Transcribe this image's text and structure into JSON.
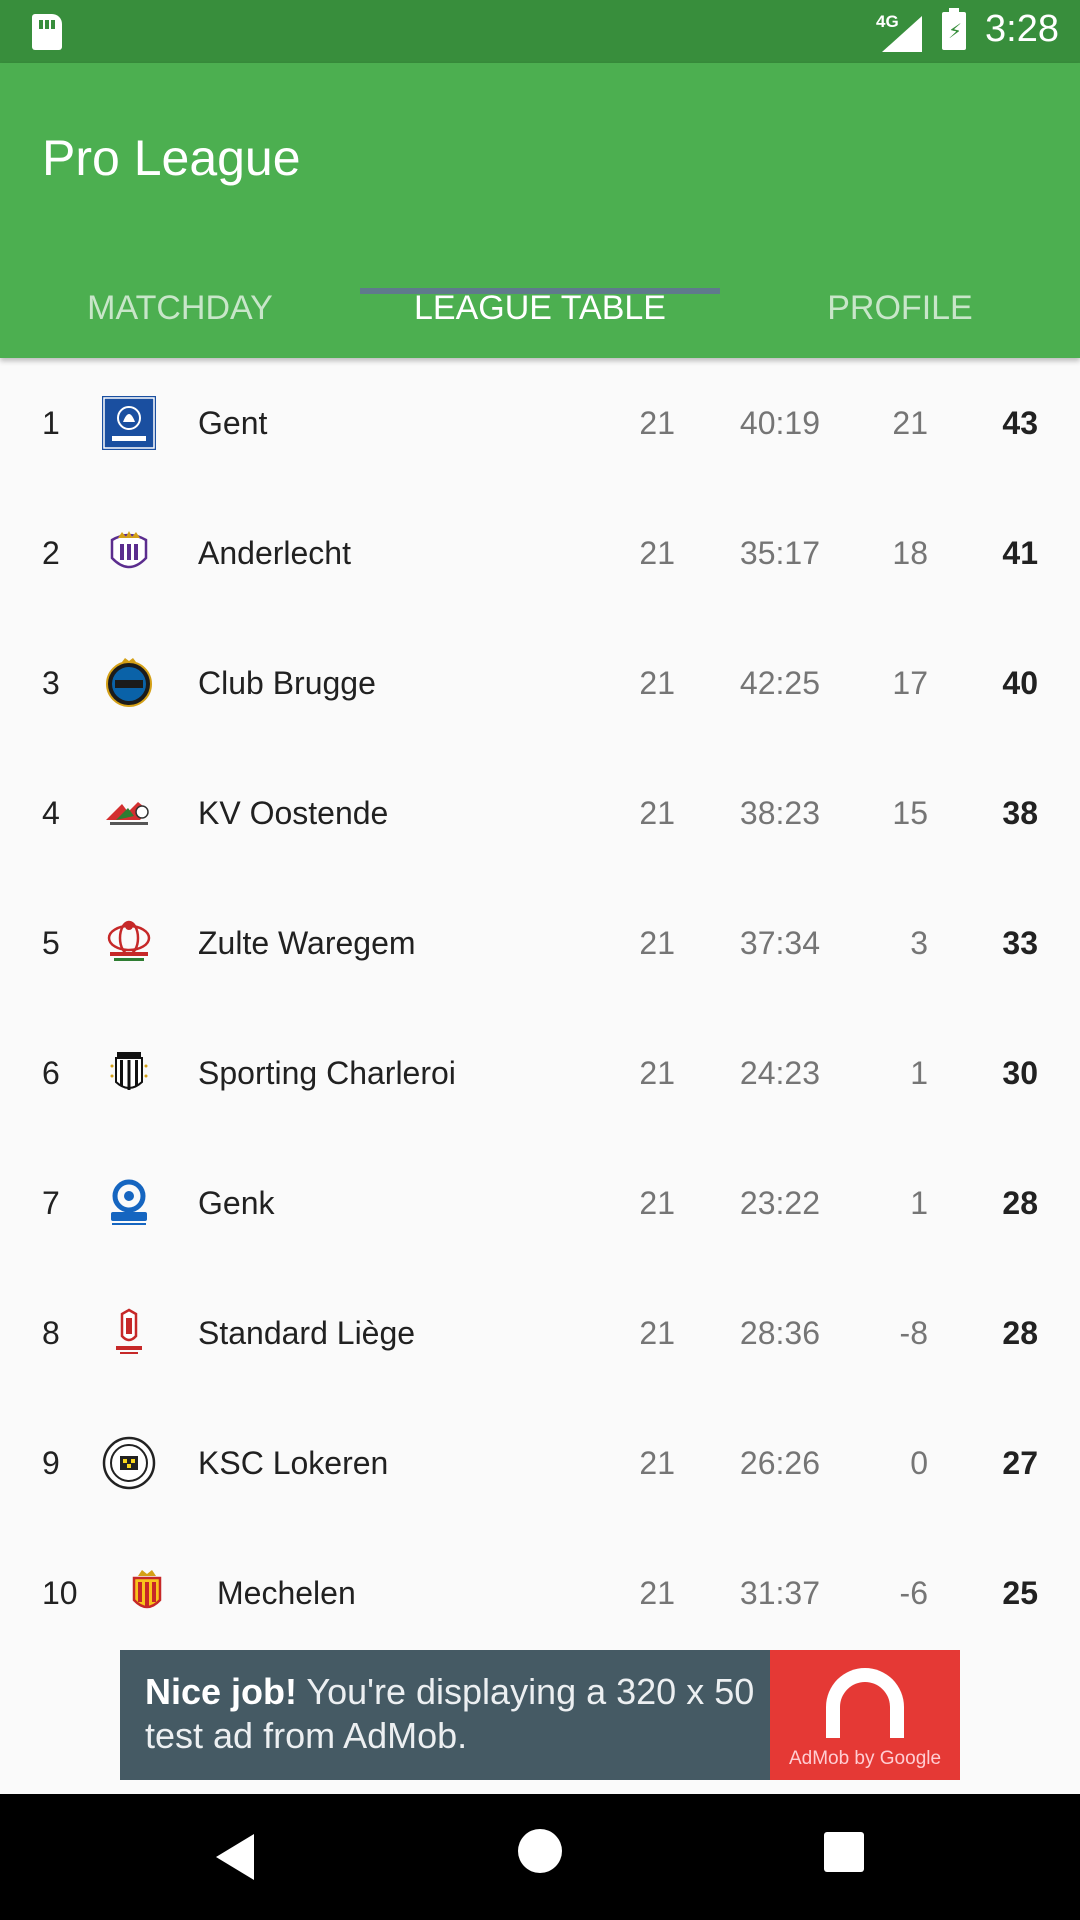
{
  "status_bar": {
    "network": "4G",
    "time": "3:28"
  },
  "app": {
    "title": "Pro League",
    "primary_color": "#4caf50",
    "status_color": "#388e3c"
  },
  "tabs": [
    {
      "label": "MATCHDAY",
      "active": false
    },
    {
      "label": "LEAGUE TABLE",
      "active": true
    },
    {
      "label": "PROFILE",
      "active": false
    }
  ],
  "standings": [
    {
      "rank": "1",
      "team": "Gent",
      "played": "21",
      "goals": "40:19",
      "goal_diff": "21",
      "points": "43"
    },
    {
      "rank": "2",
      "team": "Anderlecht",
      "played": "21",
      "goals": "35:17",
      "goal_diff": "18",
      "points": "41"
    },
    {
      "rank": "3",
      "team": "Club Brugge",
      "played": "21",
      "goals": "42:25",
      "goal_diff": "17",
      "points": "40"
    },
    {
      "rank": "4",
      "team": "KV Oostende",
      "played": "21",
      "goals": "38:23",
      "goal_diff": "15",
      "points": "38"
    },
    {
      "rank": "5",
      "team": "Zulte Waregem",
      "played": "21",
      "goals": "37:34",
      "goal_diff": "3",
      "points": "33"
    },
    {
      "rank": "6",
      "team": "Sporting Charleroi",
      "played": "21",
      "goals": "24:23",
      "goal_diff": "1",
      "points": "30"
    },
    {
      "rank": "7",
      "team": "Genk",
      "played": "21",
      "goals": "23:22",
      "goal_diff": "1",
      "points": "28"
    },
    {
      "rank": "8",
      "team": "Standard Liège",
      "played": "21",
      "goals": "28:36",
      "goal_diff": "-8",
      "points": "28"
    },
    {
      "rank": "9",
      "team": "KSC Lokeren",
      "played": "21",
      "goals": "26:26",
      "goal_diff": "0",
      "points": "27"
    },
    {
      "rank": "10",
      "team": "Mechelen",
      "played": "21",
      "goals": "31:37",
      "goal_diff": "-6",
      "points": "25"
    }
  ],
  "ad": {
    "headline": "Nice job!",
    "body": " You're displaying a 320 x 50 test ad from AdMob.",
    "brand": "AdMob by Google"
  }
}
